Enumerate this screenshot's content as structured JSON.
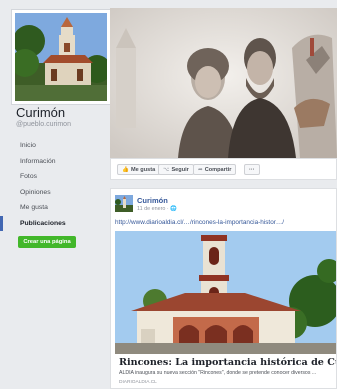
{
  "page": {
    "name": "Curimón",
    "handle": "@pueblo.curimon"
  },
  "sidebar": {
    "items": [
      {
        "label": "Inicio"
      },
      {
        "label": "Información"
      },
      {
        "label": "Fotos"
      },
      {
        "label": "Opiniones"
      },
      {
        "label": "Me gusta"
      },
      {
        "label": "Publicaciones",
        "active": true
      }
    ],
    "create_page_label": "Crear una página"
  },
  "actions": {
    "like_label": "Me gusta",
    "like_icon": "thumbs-up-icon",
    "follow_label": "Seguir",
    "follow_icon": "rss-icon",
    "share_label": "Compartir",
    "share_icon": "share-arrow-icon",
    "more_label": "···"
  },
  "post": {
    "author": "Curimón",
    "date": "11 de enero",
    "privacy_icon": "globe-icon",
    "link_url": "http://www.diarioaldia.cl/…/rincones-la-importancia-histor…/",
    "link_title": "Rincones: La importancia histórica de Curimon",
    "link_description": "ALDIA inaugura su nueva sección \"Rincones\", donde se pretende conocer diversos ...",
    "link_domain": "DIARIOALDIA.CL"
  },
  "colors": {
    "facebook_blue": "#4267b2",
    "link_blue": "#365899",
    "create_button_green": "#42b72a",
    "background": "#e9ebee"
  }
}
